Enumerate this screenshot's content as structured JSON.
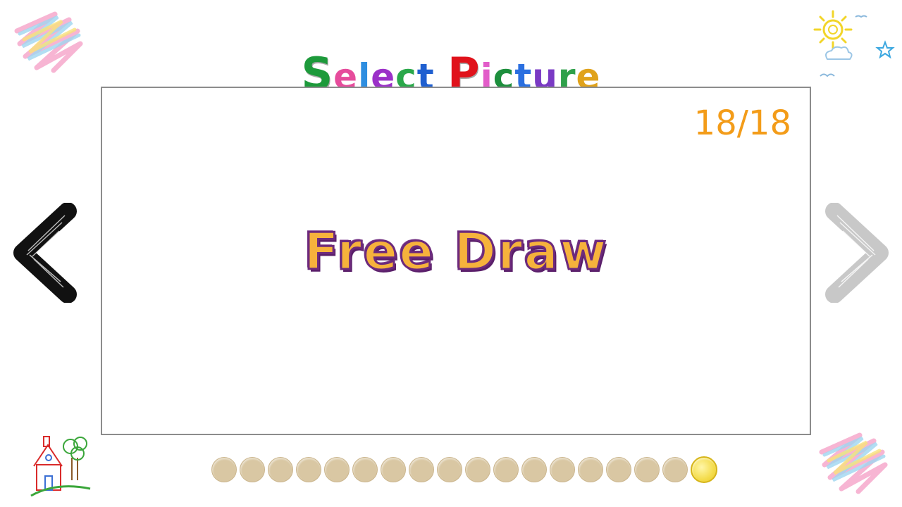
{
  "title": {
    "letters": [
      {
        "char": "S",
        "color": "#1d9a3b",
        "cap": true
      },
      {
        "char": "e",
        "color": "#e64c9c"
      },
      {
        "char": "l",
        "color": "#2e8ee0"
      },
      {
        "char": "e",
        "color": "#9b30c8"
      },
      {
        "char": "c",
        "color": "#2aa84a"
      },
      {
        "char": "t",
        "color": "#1f5fd0"
      },
      {
        "char": " ",
        "color": "#000000"
      },
      {
        "char": "P",
        "color": "#e0121b",
        "cap": true
      },
      {
        "char": "i",
        "color": "#e25cc9"
      },
      {
        "char": "c",
        "color": "#1d8f3d"
      },
      {
        "char": "t",
        "color": "#2a6fe0"
      },
      {
        "char": "u",
        "color": "#7a3ac4"
      },
      {
        "char": "r",
        "color": "#2ea04a"
      },
      {
        "char": "e",
        "color": "#e0a21a"
      }
    ]
  },
  "picture": {
    "counter": "18/18",
    "label": "Free Draw"
  },
  "pagination": {
    "total": 18,
    "current": 18
  },
  "colors": {
    "counter": "#f39c19",
    "dot_inactive": "#d9c7a3",
    "dot_active": "#f4dc4c"
  }
}
